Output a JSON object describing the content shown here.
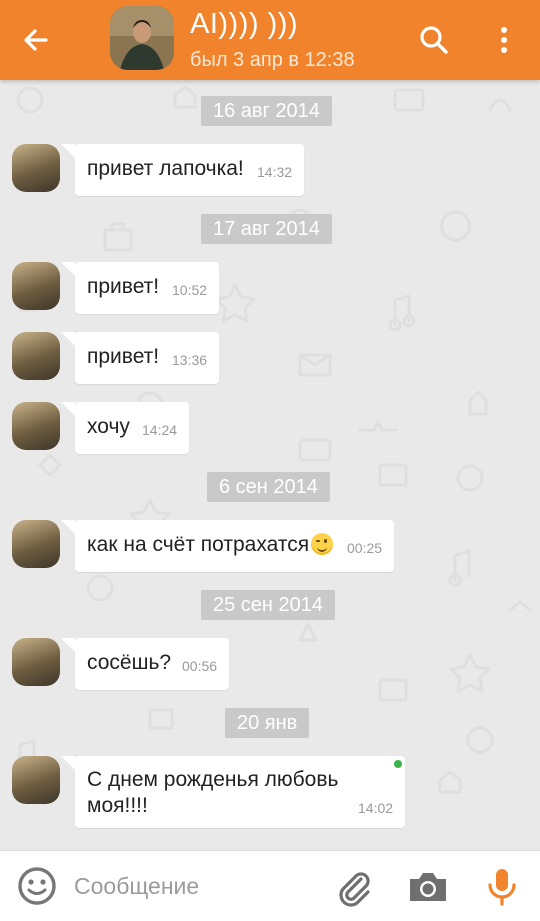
{
  "header": {
    "contact_name": "AI)))) )))",
    "status": "был 3 апр в 12:38",
    "icons": {
      "back": "arrow-left-icon",
      "search": "search-icon",
      "more": "more-vertical-icon"
    }
  },
  "messages": [
    {
      "type": "date",
      "label": "16 авг 2014"
    },
    {
      "type": "msg",
      "text": "привет лапочка!",
      "time": "14:32"
    },
    {
      "type": "date",
      "label": "17 авг 2014"
    },
    {
      "type": "msg",
      "text": "привет!",
      "time": "10:52"
    },
    {
      "type": "msg",
      "text": "привет!",
      "time": "13:36"
    },
    {
      "type": "msg",
      "text": "хочу",
      "time": "14:24"
    },
    {
      "type": "date",
      "label": "6 сен 2014"
    },
    {
      "type": "msg",
      "text": "как на счёт потрахатся",
      "time": "00:25",
      "emoji": "winking-face"
    },
    {
      "type": "date",
      "label": "25 сен 2014"
    },
    {
      "type": "msg",
      "text": "сосёшь?",
      "time": "00:56"
    },
    {
      "type": "date",
      "label": "20 янв"
    },
    {
      "type": "msg",
      "text_line1": "С днем рожденья любовь",
      "text_line2": "моя!!!!",
      "time": "14:02",
      "online": true
    }
  ],
  "input": {
    "placeholder": "Сообщение",
    "value": ""
  },
  "colors": {
    "accent": "#f0832b",
    "chat_bg": "#e9e9e9",
    "date_chip": "#c9c9c9",
    "online": "#3bb54a"
  }
}
